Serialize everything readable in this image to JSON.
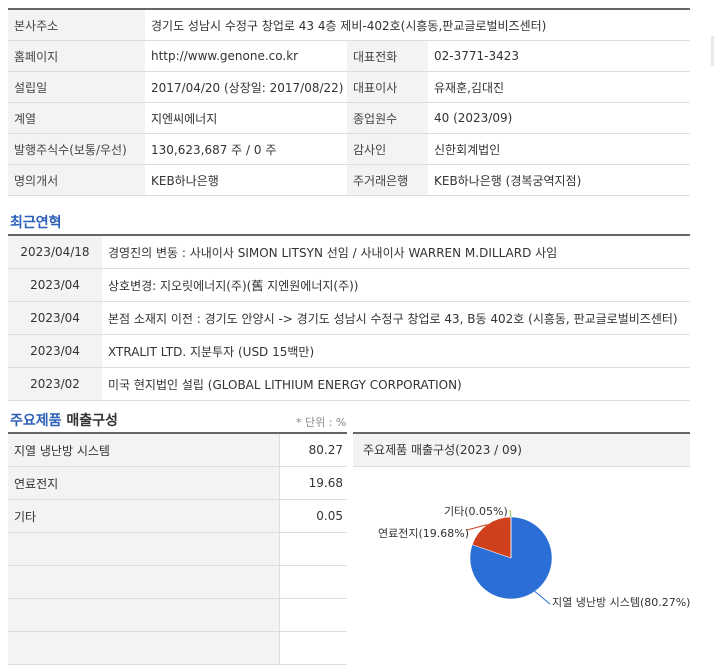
{
  "company_info": {
    "rows": [
      {
        "cells": [
          "본사주소",
          "경기도 성남시 수정구 창업로 43 4층 제비-402호(시흥동,판교글로벌비즈센터)"
        ]
      },
      {
        "cells": [
          "홈페이지",
          "http://www.genone.co.kr",
          "대표전화",
          "02-3771-3423"
        ]
      },
      {
        "cells": [
          "설립일",
          "2017/04/20 (상장일: 2017/08/22)",
          "대표이사",
          "유재훈,김대진"
        ]
      },
      {
        "cells": [
          "계열",
          "지엔씨에너지",
          "종업원수",
          "40 (2023/09)"
        ]
      },
      {
        "cells": [
          "발행주식수(보통/우선)",
          "130,623,687 주 / 0 주",
          "감사인",
          "신한회계법인"
        ]
      },
      {
        "cells": [
          "명의개서",
          "KEB하나은행",
          "주거래은행",
          "KEB하나은행 (경복궁역지점)"
        ]
      }
    ]
  },
  "history": {
    "title": "최근연혁",
    "items": [
      {
        "date": "2023/04/18",
        "text": "경영진의 변동 : 사내이사 SIMON LITSYN 선임 / 사내이사 WARREN M.DILLARD 사임"
      },
      {
        "date": "2023/04",
        "text": "상호변경: 지오릿에너지(주)(舊 지엔원에너지(주))"
      },
      {
        "date": "2023/04",
        "text": "본점 소재지 이전 : 경기도 안양시 -> 경기도 성남시 수정구 창업로 43, B동 402호 (시흥동, 판교글로벌비즈센터)"
      },
      {
        "date": "2023/04",
        "text": "XTRALIT LTD. 지분투자 (USD 15백만)"
      },
      {
        "date": "2023/02",
        "text": "미국 현지법인 설립 (GLOBAL LITHIUM ENERGY CORPORATION)"
      }
    ]
  },
  "products": {
    "title_highlight": "주요제품",
    "title_rest": " 매출구성",
    "unit": "* 단위 : %",
    "rows": [
      {
        "name": "지열 냉난방 시스템",
        "value": "80.27"
      },
      {
        "name": "연료전지",
        "value": "19.68"
      },
      {
        "name": "기타",
        "value": "0.05"
      },
      {
        "name": "",
        "value": ""
      },
      {
        "name": "",
        "value": ""
      },
      {
        "name": "",
        "value": ""
      },
      {
        "name": "",
        "value": ""
      }
    ]
  },
  "chart_panel": {
    "header": "주요제품 매출구성(2023 / 09)"
  },
  "colors": {
    "section_accent": "#2c5fb8",
    "slice_geothermal": "#2b6fd6",
    "slice_fuelcell": "#d1401d",
    "slice_other": "#8ac43f"
  },
  "chart_data": {
    "type": "pie",
    "title": "주요제품 매출구성(2023 / 09)",
    "categories": [
      "지열 냉난방 시스템",
      "연료전지",
      "기타"
    ],
    "values": [
      80.27,
      19.68,
      0.05
    ],
    "labels": [
      "지열 냉난방 시스템(80.27%)",
      "연료전지(19.68%)",
      "기타(0.05%)"
    ]
  }
}
